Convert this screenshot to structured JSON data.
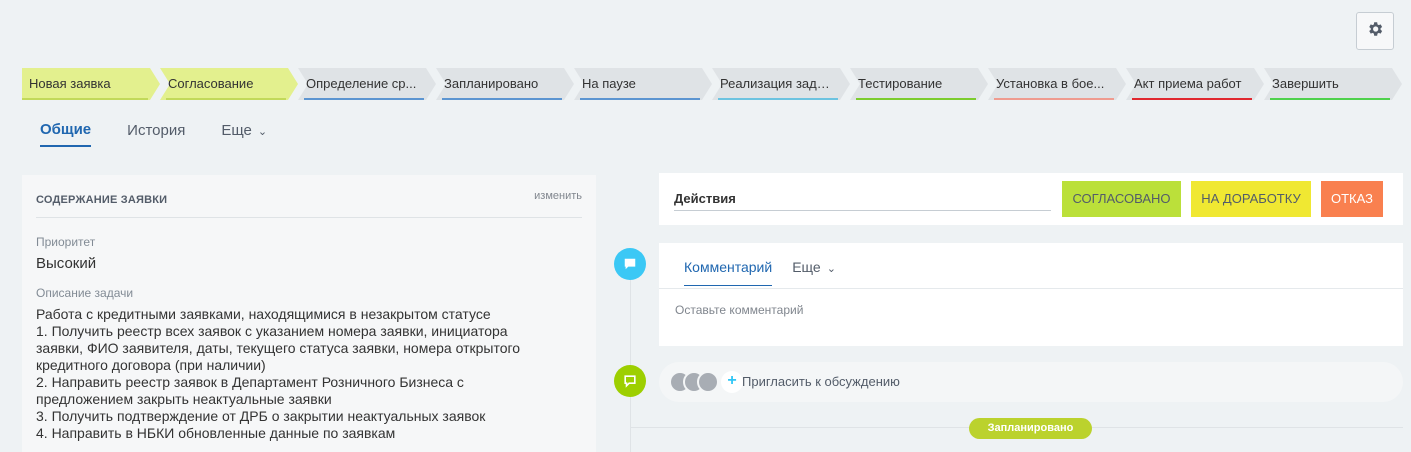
{
  "settings": {
    "icon": "gear-icon"
  },
  "stages": [
    {
      "label": "Новая заявка",
      "bar_color": "#c2d95a",
      "done": true
    },
    {
      "label": "Согласование",
      "bar_color": "#c2d95a",
      "done": true
    },
    {
      "label": "Определение ср...",
      "bar_color": "#5c95d1",
      "done": false
    },
    {
      "label": "Запланировано",
      "bar_color": "#5c95d1",
      "done": false
    },
    {
      "label": "На паузе",
      "bar_color": "#5c95d1",
      "done": false
    },
    {
      "label": "Реализация зада...",
      "bar_color": "#6cc3e0",
      "done": false
    },
    {
      "label": "Тестирование",
      "bar_color": "#7ccc2e",
      "done": false
    },
    {
      "label": "Установка в бое...",
      "bar_color": "#ef9b8f",
      "done": false
    },
    {
      "label": "Акт приема работ",
      "bar_color": "#e0282f",
      "done": false
    },
    {
      "label": "Завершить",
      "bar_color": "#4fd14c",
      "done": false
    }
  ],
  "tabs": {
    "general": "Общие",
    "history": "История",
    "more": "Еще"
  },
  "request_panel": {
    "title": "СОДЕРЖАНИЕ ЗАЯВКИ",
    "edit": "изменить",
    "priority_label": "Приоритет",
    "priority_value": "Высокий",
    "description_label": "Описание задачи",
    "description_lines": [
      "Работа с кредитными заявками, находящимися в незакрытом статусе",
      "1. Получить реестр всех заявок с указанием номера заявки, инициатора",
      "заявки, ФИО заявителя, даты, текущего статуса заявки, номера открытого",
      "кредитного договора (при наличии)",
      "2. Направить реестр заявок в Департамент Розничного Бизнеса с",
      "предложением закрыть неактуальные заявки",
      "3. Получить подтверждение от ДРБ о закрытии неактуальных заявок",
      "4. Направить в НБКИ обновленные данные по заявкам"
    ]
  },
  "actions": {
    "title": "Действия",
    "approved": "Согласовано",
    "rework": "На доработку",
    "reject": "Отказ",
    "colors": {
      "approved": "#bbe03a",
      "rework": "#f0e832",
      "reject": "#f9804f"
    }
  },
  "comment": {
    "tab_comment": "Комментарий",
    "tab_more": "Еще",
    "placeholder": "Оставьте комментарий"
  },
  "invite": {
    "text": "Пригласить к обсуждению"
  },
  "timeline": {
    "status_pill": "Запланировано",
    "comment_icon_color": "#3bc8f5",
    "chat_icon_color": "#9dcf00"
  }
}
